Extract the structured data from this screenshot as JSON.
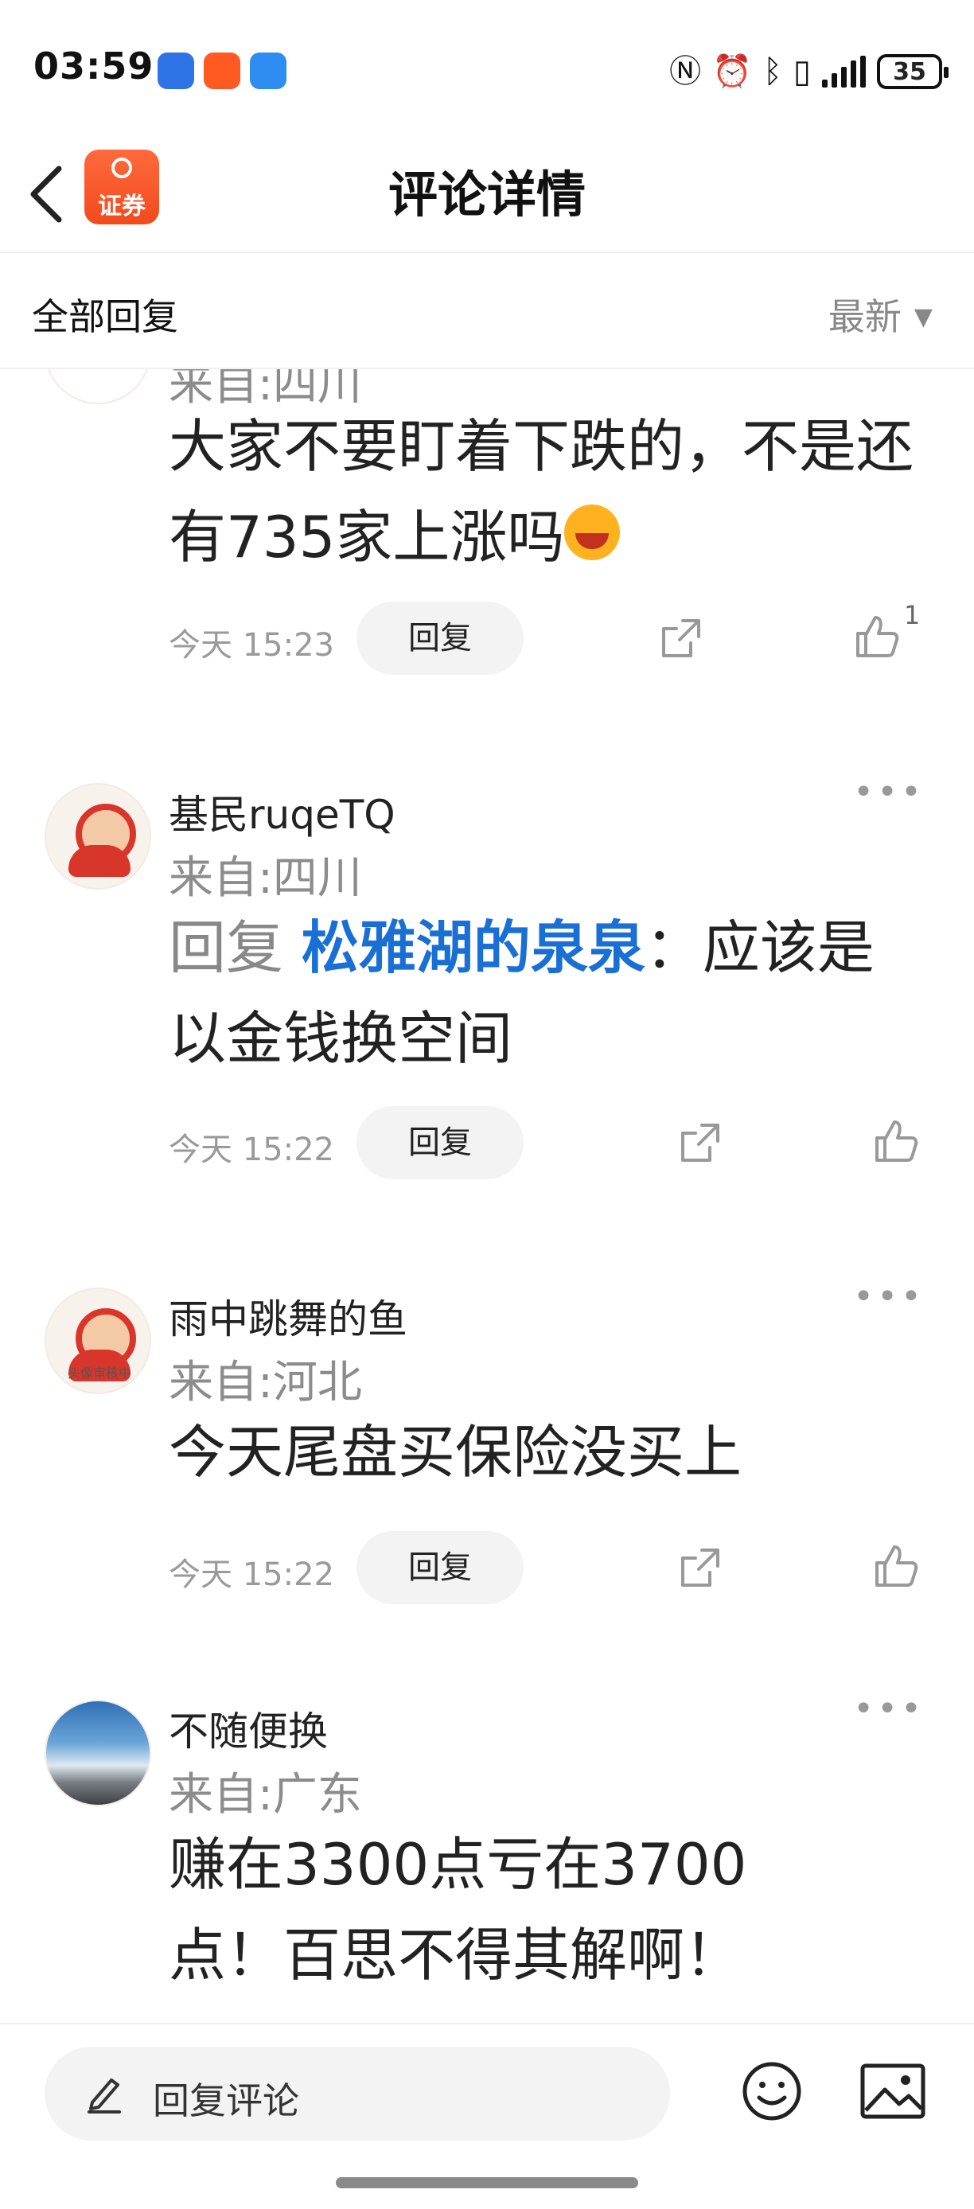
{
  "status_bar": {
    "time": "03:59",
    "battery": "35",
    "app_icon_colors": [
      "#2f74e6",
      "#ff5a22",
      "#2f8cf0"
    ],
    "icons": [
      "nfc-icon",
      "alarm-icon",
      "bluetooth-icon",
      "vibrate-icon",
      "signal-icon",
      "battery-icon"
    ]
  },
  "nav": {
    "back_icon": "chevron-left-icon",
    "app_logo_text": "证券",
    "title": "评论详情"
  },
  "filter": {
    "label": "全部回复",
    "sort": "最新"
  },
  "comments": [
    {
      "location": "来自:四川",
      "content": "大家不要盯着下跌的，不是还有735家上涨吗",
      "emoji": "laughing-emoji",
      "date": "今天 15:23",
      "reply_label": "回复",
      "likes": "1"
    },
    {
      "username": "基民ruqeTQ",
      "location": "来自:四川",
      "reply_prefix": "回复",
      "mention": "松雅湖的泉泉",
      "content": "：应该是以金钱换空间",
      "date": "今天 15:22",
      "reply_label": "回复"
    },
    {
      "username": "雨中跳舞的鱼",
      "avatar_caption": "头像审核中",
      "location": "来自:河北",
      "content": "今天尾盘买保险没买上",
      "date": "今天 15:22",
      "reply_label": "回复"
    },
    {
      "username": "不随便换",
      "location": "来自:广东",
      "content": "赚在3300点亏在3700点！百思不得其解啊！"
    }
  ],
  "bottom_bar": {
    "placeholder": "回复评论",
    "icons": [
      "edit-icon",
      "emoji-icon",
      "image-icon"
    ]
  },
  "colors": {
    "accent_link": "#1a6fd4",
    "brand_orange": "#f24a1c",
    "muted_text": "#8c8c8c"
  }
}
